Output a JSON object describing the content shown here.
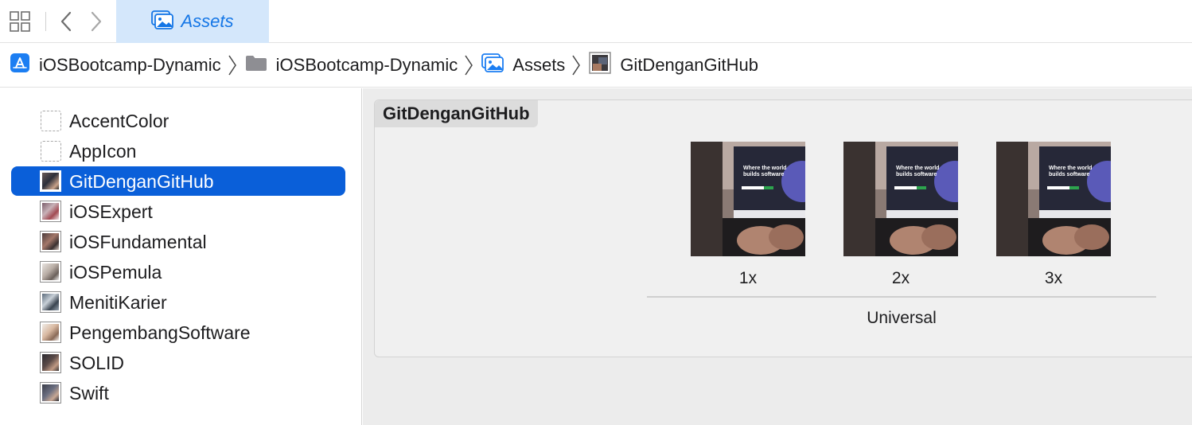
{
  "tabbar": {
    "active_tab": {
      "label": "Assets",
      "icon": "asset-catalog-icon"
    },
    "icons": [
      "related-items-grid-icon",
      "back-chevron-icon",
      "forward-chevron-icon"
    ]
  },
  "jumpbar": {
    "crumbs": [
      {
        "label": "iOSBootcamp-Dynamic",
        "icon": "xcode-project-icon"
      },
      {
        "label": "iOSBootcamp-Dynamic",
        "icon": "folder-icon"
      },
      {
        "label": "Assets",
        "icon": "asset-catalog-icon"
      },
      {
        "label": "GitDenganGitHub",
        "icon": "image-set-icon"
      }
    ]
  },
  "sidebar": {
    "items": [
      {
        "label": "AccentColor",
        "icon": "color-set-icon",
        "selected": false
      },
      {
        "label": "AppIcon",
        "icon": "app-icon-set-icon",
        "selected": false
      },
      {
        "label": "GitDenganGitHub",
        "icon": "image-set-icon",
        "selected": true
      },
      {
        "label": "iOSExpert",
        "icon": "image-set-icon",
        "selected": false
      },
      {
        "label": "iOSFundamental",
        "icon": "image-set-icon",
        "selected": false
      },
      {
        "label": "iOSPemula",
        "icon": "image-set-icon",
        "selected": false
      },
      {
        "label": "MenitiKarier",
        "icon": "image-set-icon",
        "selected": false
      },
      {
        "label": "PengembangSoftware",
        "icon": "image-set-icon",
        "selected": false
      },
      {
        "label": "SOLID",
        "icon": "image-set-icon",
        "selected": false
      },
      {
        "label": "Swift",
        "icon": "image-set-icon",
        "selected": false
      }
    ]
  },
  "editor": {
    "asset_name": "GitDenganGitHub",
    "slots": [
      {
        "scale": "1x",
        "image_text": "Where the world builds software"
      },
      {
        "scale": "2x",
        "image_text": "Where the world builds software"
      },
      {
        "scale": "3x",
        "image_text": "Where the world builds software"
      }
    ],
    "device_group": "Universal"
  },
  "colors": {
    "accent": "#1476e6",
    "selection": "#0a5fd9",
    "tab_active_bg": "#d4e7fb",
    "editor_bg": "#ececec"
  }
}
